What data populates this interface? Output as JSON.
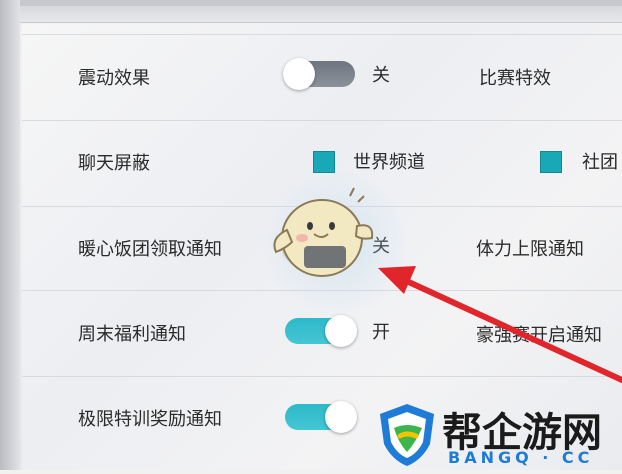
{
  "settings": [
    {
      "label": "震动效果",
      "control": "toggle",
      "state": "关",
      "on": false,
      "right_label": "比赛特效"
    },
    {
      "label": "聊天屏蔽",
      "control": "checkboxes",
      "options": [
        {
          "label": "世界频道",
          "checked": true
        },
        {
          "label": "社团",
          "checked": true
        }
      ]
    },
    {
      "label": "暖心饭团领取通知",
      "control": "toggle",
      "state": "关",
      "on": false,
      "right_label": "体力上限通知"
    },
    {
      "label": "周末福利通知",
      "control": "toggle",
      "state": "开",
      "on": true,
      "right_label": "豪强赛开启通知"
    },
    {
      "label": "极限特训奖励通知",
      "control": "toggle",
      "state": "",
      "on": true
    }
  ],
  "watermark": {
    "title": "帮企游网",
    "subtitle": "BANGQ · CC"
  },
  "colors": {
    "toggle_on": "#2db9c8",
    "toggle_off": "#7a808a",
    "checkbox": "#19a9b6",
    "arrow": "#e0262b"
  },
  "icons": {
    "mascot": "rice-ball-mascot-icon",
    "arrow": "red-pointer-arrow-icon",
    "logo": "bangq-shield-logo-icon"
  }
}
